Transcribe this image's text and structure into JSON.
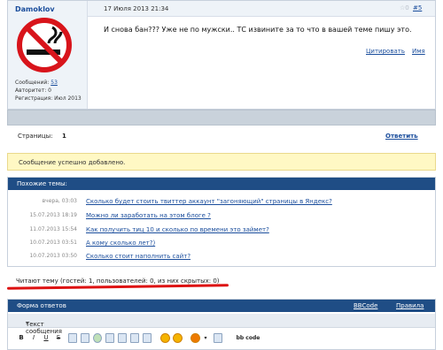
{
  "post": {
    "author": "Damoklov",
    "stats": {
      "messages_label": "Сообщений:",
      "messages_value": "53",
      "authority": "Авторитет: 0",
      "registration": "Регистрация: Июл 2013"
    },
    "date": "17 Июля 2013 21:34",
    "star": "☆0",
    "number": "#5",
    "text": "И снова бан??? Уже не по мужски.. ТС извините за то что в вашей теме пишу это.",
    "quote_label": "Цитировать",
    "name_label": "Имя"
  },
  "pagination": {
    "label": "Страницы:",
    "current": "1",
    "reply_label": "Ответить"
  },
  "notice": "Сообщение успешно добавлено.",
  "similar": {
    "header": "Похожие темы:",
    "threads": [
      {
        "date": "вчера, 03:03",
        "title": "Сколько будет стоить твиттер аккаунт \"загоняющий\" страницы в Яндекс?"
      },
      {
        "date": "15.07.2013 18:19",
        "title": "Можно ли заработать на этом блоге ?"
      },
      {
        "date": "11.07.2013 15:54",
        "title": "Как получить тиц 10 и сколько по времени это займет?"
      },
      {
        "date": "10.07.2013 03:51",
        "title": "А кому сколько лет?)"
      },
      {
        "date": "10.07.2013 03:50",
        "title": "Сколько стоит наполнить сайт?"
      }
    ]
  },
  "readers": "Читают тему (гостей: 1, пользователей: 0, из них скрытых: 0)",
  "reply_form": {
    "header": "Форма ответов",
    "bbcode_label": "BBCode",
    "rules_label": "Правила",
    "text_label": "Текст сообщения",
    "required_mark": "*",
    "toolbar": [
      "B",
      "I",
      "U",
      "S",
      "bb code"
    ]
  }
}
